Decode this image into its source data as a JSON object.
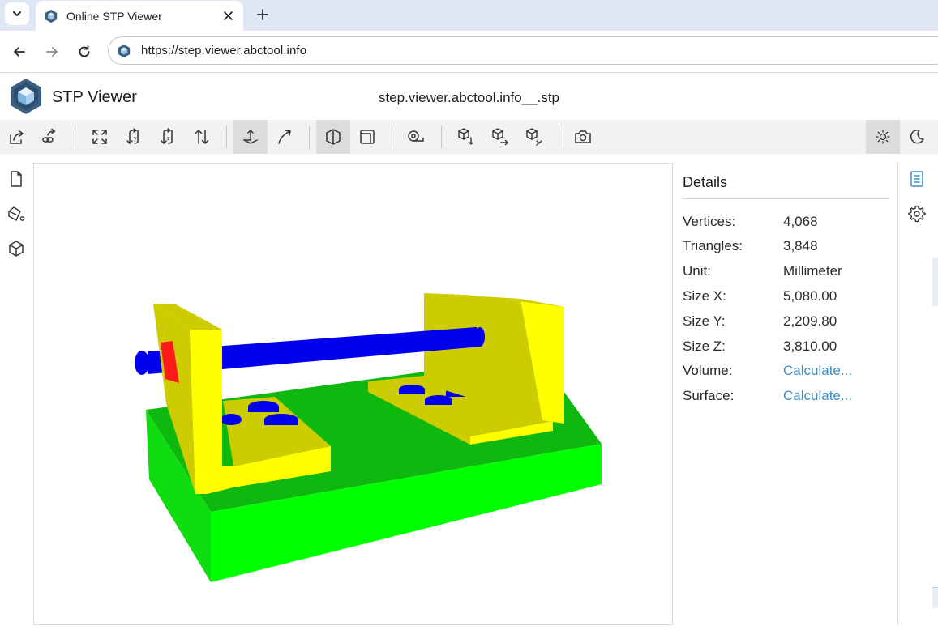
{
  "browser": {
    "tab_title": "Online STP Viewer",
    "url": "https://step.viewer.abctool.info",
    "icons": {
      "tab_menu": "chevron-down-icon",
      "tab_close": "close-icon",
      "new_tab": "plus-icon",
      "back": "arrow-left-icon",
      "forward": "arrow-right-icon",
      "reload": "reload-icon"
    }
  },
  "app": {
    "name": "STP Viewer",
    "file_name": "step.viewer.abctool.info__.stp",
    "accent": "#3a5f82"
  },
  "toolbar": {
    "groups": [
      [
        "open-file-icon",
        "open-url-icon"
      ],
      [
        "fit-view-icon",
        "flip-up-icon",
        "rotate-icon",
        "up-down-icon"
      ],
      [
        "fixed-up-vector-icon",
        "free-orbit-icon"
      ],
      [
        "perspective-camera-icon",
        "orthographic-camera-icon"
      ],
      [
        "measure-icon"
      ],
      [
        "view-bottom-icon",
        "view-side-icon",
        "view-isometric-icon"
      ],
      [
        "snapshot-icon"
      ]
    ],
    "right": [
      "light-mode-icon",
      "dark-mode-icon"
    ],
    "active": [
      "fixed-up-vector-icon",
      "perspective-camera-icon",
      "light-mode-icon"
    ]
  },
  "left_sidebar": [
    "files-icon",
    "materials-icon",
    "meshes-icon"
  ],
  "right_sidebar": [
    "details-icon",
    "settings-icon"
  ],
  "details": {
    "title": "Details",
    "rows": [
      {
        "label": "Vertices:",
        "value": "4,068",
        "link": false
      },
      {
        "label": "Triangles:",
        "value": "3,848",
        "link": false
      },
      {
        "label": "Unit:",
        "value": "Millimeter",
        "link": false
      },
      {
        "label": "Size X:",
        "value": "5,080.00",
        "link": false
      },
      {
        "label": "Size Y:",
        "value": "2,209.80",
        "link": false
      },
      {
        "label": "Size Z:",
        "value": "3,810.00",
        "link": false
      },
      {
        "label": "Volume:",
        "value": "Calculate...",
        "link": true
      },
      {
        "label": "Surface:",
        "value": "Calculate...",
        "link": true
      }
    ]
  },
  "model_colors": {
    "base_top": "#0eb80e",
    "base_front": "#00ff00",
    "base_side": "#10dd10",
    "bracket_face": "#ffff00",
    "bracket_side": "#cccc00",
    "rod": "#0000ee",
    "tab": "#ff1a1a"
  }
}
